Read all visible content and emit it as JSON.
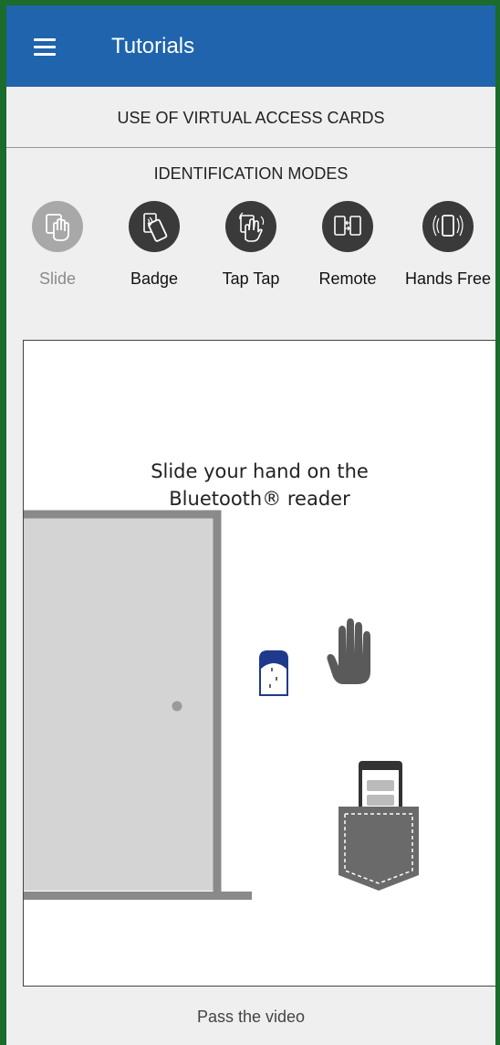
{
  "appbar": {
    "title": "Tutorials",
    "menu_icon": "hamburger-menu-icon"
  },
  "sections": {
    "virtual_cards": "USE OF VIRTUAL ACCESS CARDS",
    "identification_modes": "IDENTIFICATION MODES"
  },
  "modes": [
    {
      "label": "Slide",
      "icon": "hand-slide-icon",
      "active": true
    },
    {
      "label": "Badge",
      "icon": "phone-badge-icon",
      "active": false
    },
    {
      "label": "Tap Tap",
      "icon": "tap-tap-icon",
      "active": false
    },
    {
      "label": "Remote",
      "icon": "remote-icon",
      "active": false
    },
    {
      "label": "Hands Free",
      "icon": "hands-free-icon",
      "active": false
    }
  ],
  "video": {
    "caption_line1": "Slide your hand on the",
    "caption_line2": "Bluetooth® reader"
  },
  "footer": {
    "pass_video": "Pass the video"
  },
  "colors": {
    "appbar": "#1f64ad",
    "border": "#1a6b2c",
    "active_mode": "#a8a8a8",
    "inactive_mode": "#3a3a3a"
  }
}
